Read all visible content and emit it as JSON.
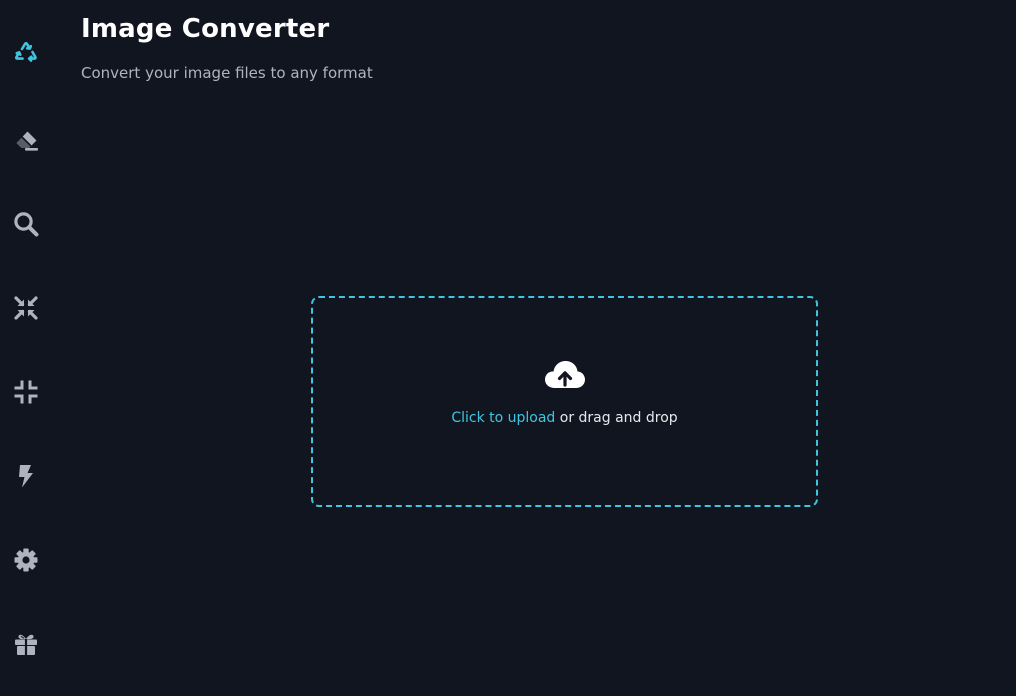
{
  "page": {
    "title": "Image Converter",
    "subtitle": "Convert your image files to any format"
  },
  "sidebar": {
    "items": [
      {
        "icon": "recycle-icon",
        "active": true
      },
      {
        "icon": "eraser-icon",
        "active": false
      },
      {
        "icon": "search-icon",
        "active": false
      },
      {
        "icon": "compress-arrows-icon",
        "active": false
      },
      {
        "icon": "compress-icon",
        "active": false
      },
      {
        "icon": "bolt-icon",
        "active": false
      },
      {
        "icon": "gear-icon",
        "active": false
      },
      {
        "icon": "gift-icon",
        "active": false
      }
    ]
  },
  "upload": {
    "icon": "cloud-upload-icon",
    "link_text": "Click to upload",
    "rest_text": "or drag and drop"
  },
  "colors": {
    "background": "#111520",
    "accent": "#3fc6de",
    "icon_inactive": "#aeb4bf",
    "subtitle": "#aeb4bf",
    "text": "#ffffff"
  }
}
